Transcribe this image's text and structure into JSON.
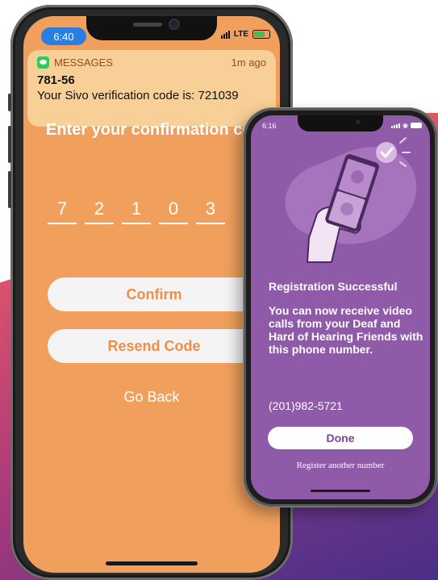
{
  "phone1": {
    "status_time": "6:40",
    "network": "LTE",
    "notification": {
      "app_name": "MESSAGES",
      "time": "1m ago",
      "sender": "781-56",
      "body": "Your Sivo verification code is: 721039"
    },
    "title": "Enter your confirmation co",
    "code_digits": [
      "7",
      "2",
      "1",
      "0",
      "3"
    ],
    "confirm_label": "Confirm",
    "resend_label": "Resend Code",
    "go_back_label": "Go Back"
  },
  "phone2": {
    "status_time": "6:16",
    "heading": "Registration Successful",
    "message": "You can now receive video calls from your Deaf and Hard of Hearing Friends with this phone number.",
    "phone_number": "(201)982-5721",
    "done_label": "Done",
    "register_another_label": "Register another number"
  },
  "colors": {
    "phone1_screen": "#f0a05c",
    "notification_bg": "#f8cf97",
    "phone2_screen": "#8f5aa8",
    "button_text_orange": "#ef8f47",
    "button_text_purple": "#7f3f9c"
  },
  "icons": [
    "messages-icon",
    "signal-icon",
    "battery-icon",
    "wifi-icon",
    "checkmark-icon"
  ]
}
